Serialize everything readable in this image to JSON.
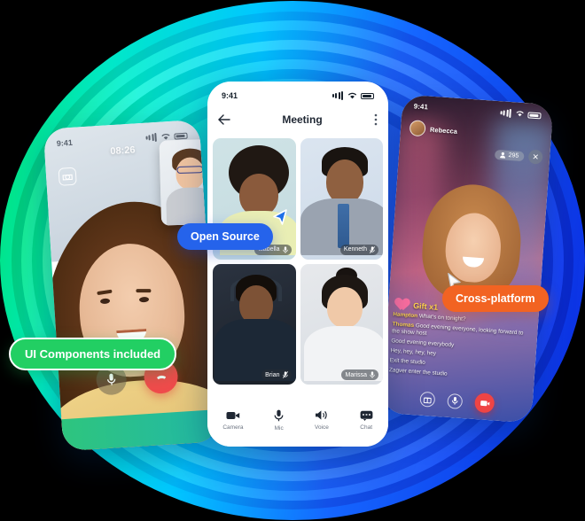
{
  "background": {
    "ring_colors": [
      "#00f0ff",
      "#00e5a0",
      "#22dd66",
      "#00c2ff",
      "#1560ff",
      "#0b2fd6"
    ],
    "base_color": "#000000"
  },
  "badges": [
    {
      "id": "ui-components",
      "label": "UI Components included",
      "color": "#22cf63"
    },
    {
      "id": "open-source",
      "label": "Open Source",
      "color": "#2563eb"
    },
    {
      "id": "cross-platform",
      "label": "Cross-platform",
      "color": "#f26322"
    }
  ],
  "left_phone": {
    "status_time": "9:41",
    "call_timer": "08:26",
    "flip_camera_icon": "camera-flip-icon",
    "mic_icon": "microphone-icon",
    "end_call_icon": "phone-hangup-icon",
    "pip_label": "picture-in-picture"
  },
  "center_phone": {
    "status_time": "9:41",
    "title": "Meeting",
    "back_icon": "arrow-left-icon",
    "more_icon": "more-vertical-icon",
    "participants": [
      {
        "name": "Isabella",
        "mic": "mic-on-icon"
      },
      {
        "name": "Kenneth",
        "mic": "mic-off-icon"
      },
      {
        "name": "Brian",
        "mic": "mic-off-icon"
      },
      {
        "name": "Marissa",
        "mic": "mic-on-icon"
      }
    ],
    "nav": [
      {
        "label": "Camera",
        "icon": "video-camera-icon"
      },
      {
        "label": "Mic",
        "icon": "microphone-icon"
      },
      {
        "label": "Voice",
        "icon": "speaker-icon"
      },
      {
        "label": "Chat",
        "icon": "chat-bubble-icon"
      }
    ]
  },
  "right_phone": {
    "status_time": "9:41",
    "host_name": "Rebecca",
    "viewer_count": "295",
    "close_icon": "close-icon",
    "gift_label": "Gift x1",
    "gift_icon": "heart-icon",
    "chat": [
      {
        "user": "Hampton",
        "text": "What's on tonight?"
      },
      {
        "user": "Thomas",
        "text": "Good evening everyone, looking forward to the show host"
      },
      {
        "user": "",
        "text": "Good evening everybody"
      },
      {
        "user": "",
        "text": "Hey, hey, hey, hey"
      },
      {
        "user": "",
        "text": "Exit the studio"
      },
      {
        "user": "",
        "text": "Zagver enter the studio"
      }
    ],
    "controls": [
      {
        "icon": "gift-icon"
      },
      {
        "icon": "microphone-icon"
      },
      {
        "icon": "end-stream-icon"
      }
    ]
  }
}
